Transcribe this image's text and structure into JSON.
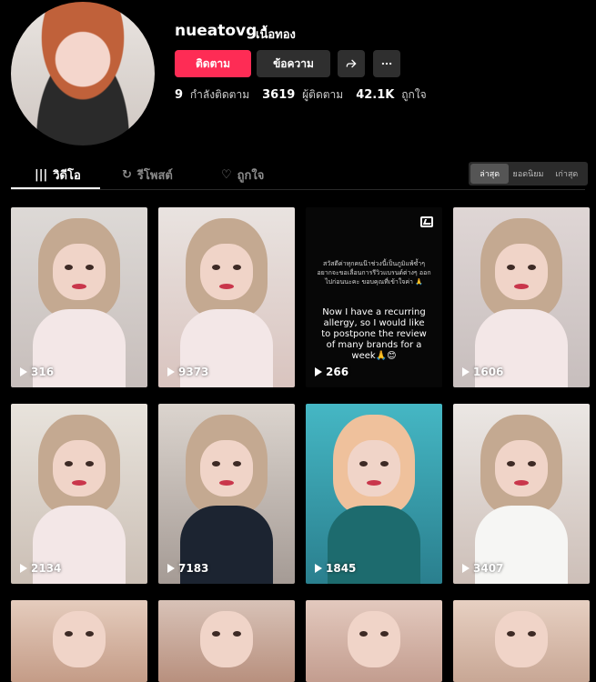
{
  "profile": {
    "username": "nueatovg",
    "nickname": "เนื้อทอง",
    "follow_button": "ติดตาม",
    "message_button": "ข้อความ",
    "stats": [
      {
        "value": "9",
        "label": "กำลังติดตาม"
      },
      {
        "value": "3619",
        "label": "ผู้ติดตาม"
      },
      {
        "value": "42.1K",
        "label": "ถูกใจ"
      }
    ]
  },
  "tabs": [
    {
      "label": "วิดีโอ",
      "icon": "grid-icon",
      "active": true
    },
    {
      "label": "รีโพสต์",
      "icon": "repost-icon",
      "active": false
    },
    {
      "label": "ถูกใจ",
      "icon": "heart-icon",
      "active": false
    }
  ],
  "sort": [
    {
      "label": "ล่าสุด",
      "active": true
    },
    {
      "label": "ยอดนิยม",
      "active": false
    },
    {
      "label": "เก่าสุด",
      "active": false
    }
  ],
  "videos": [
    {
      "views": "316"
    },
    {
      "views": "9373"
    },
    {
      "views": "266",
      "photo": true,
      "caption_small": "สวัสดีค่าทุกคนน๊าช่วงนี้เป็นภูมิแพ้ซ้ำๆ อยากจะขอเลื่อนการรีวิวแบรนด์ต่างๆ ออกไปก่อนนะคะ ขอบคุณที่เข้าใจค่า 🙏",
      "caption": "Now I have a recurring allergy, so I would like to postpone the review of many brands for a week🙏😊"
    },
    {
      "views": "1606"
    },
    {
      "views": "2134"
    },
    {
      "views": "7183"
    },
    {
      "views": "1845"
    },
    {
      "views": "3407"
    },
    {
      "views": ""
    },
    {
      "views": ""
    },
    {
      "views": ""
    },
    {
      "views": ""
    }
  ]
}
